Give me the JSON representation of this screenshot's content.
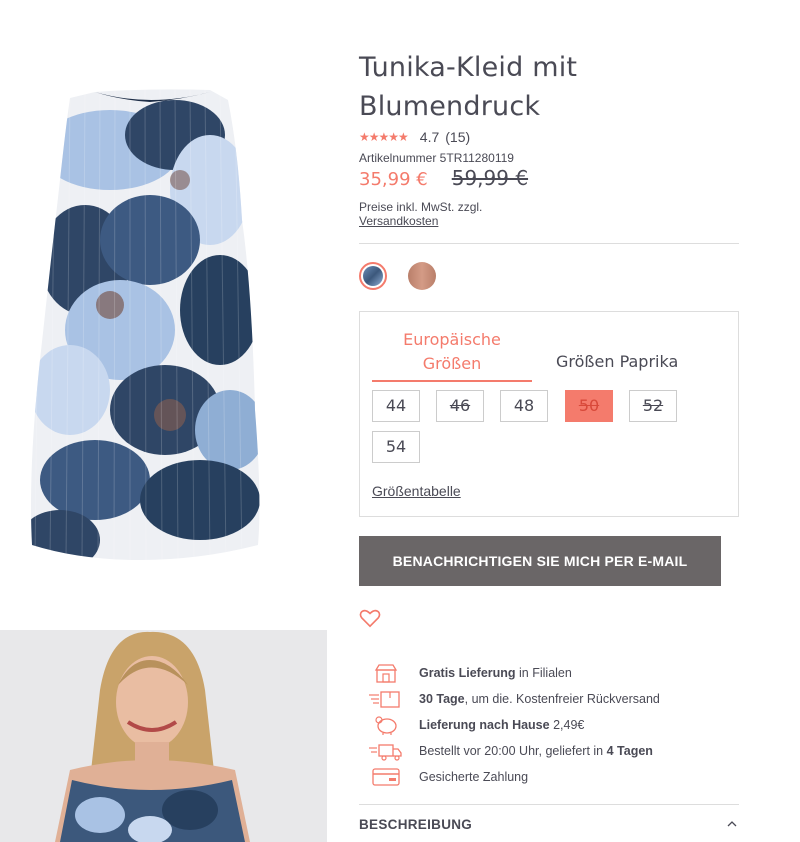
{
  "product": {
    "title": "Tunika-Kleid mit Blumendruck",
    "stars": "★★★★★",
    "rating": "4.7",
    "rating_count": "(15)",
    "sku": "Artikelnummer 5TR11280119",
    "price_new": "35,99 €",
    "price_old": "59,99 €",
    "tax_text": "Preise inkl. MwSt. zzgl.",
    "shipping_link": "Versandkosten"
  },
  "colors": {
    "accent": "#f47b6c",
    "button": "#6a6667",
    "text": "#4a4a55"
  },
  "sizes": {
    "tab_eu": "Europäische Größen",
    "tab_paprika": "Größen Paprika",
    "options": [
      {
        "label": "44",
        "available": true,
        "selected": false
      },
      {
        "label": "46",
        "available": false,
        "selected": false
      },
      {
        "label": "48",
        "available": true,
        "selected": false
      },
      {
        "label": "50",
        "available": false,
        "selected": true
      },
      {
        "label": "52",
        "available": false,
        "selected": false
      },
      {
        "label": "54",
        "available": true,
        "selected": false
      }
    ],
    "size_table_link": "Größentabelle"
  },
  "notify_button": "BENACHRICHTIGEN SIE MICH PER E-MAIL",
  "services": [
    {
      "icon": "store-icon",
      "bold": "Gratis Lieferung",
      "text": " in Filialen",
      "bold2": ""
    },
    {
      "icon": "return-box-icon",
      "bold": "30 Tage",
      "text": ", um die. Kostenfreier Rückversand",
      "bold2": ""
    },
    {
      "icon": "home-delivery-icon",
      "bold": "Lieferung nach Hause",
      "text": " 2,49€",
      "bold2": ""
    },
    {
      "icon": "fast-truck-icon",
      "bold": "",
      "text": "Bestellt vor 20:00 Uhr, geliefert in ",
      "bold2": "4 Tagen"
    },
    {
      "icon": "credit-card-icon",
      "bold": "",
      "text": "Gesicherte Zahlung",
      "bold2": ""
    }
  ],
  "description_header": "BESCHREIBUNG"
}
